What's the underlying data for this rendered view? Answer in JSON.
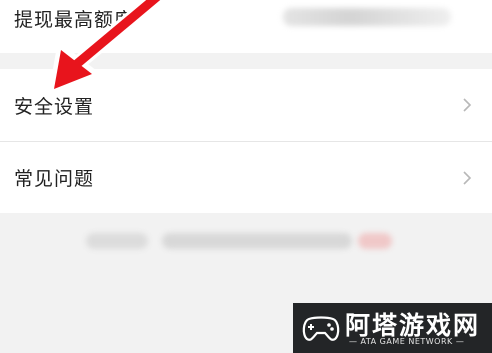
{
  "menu": {
    "items": [
      {
        "label": "提现最高额度"
      },
      {
        "label": "安全设置"
      },
      {
        "label": "常见问题"
      }
    ]
  },
  "watermark": {
    "title": "阿塔游戏网",
    "subtitle": "— ATA GAME NETWORK —"
  },
  "colors": {
    "background": "#f2f2f2",
    "row": "#ffffff",
    "arrow": "#e8141c",
    "watermark_bg": "#232527"
  }
}
